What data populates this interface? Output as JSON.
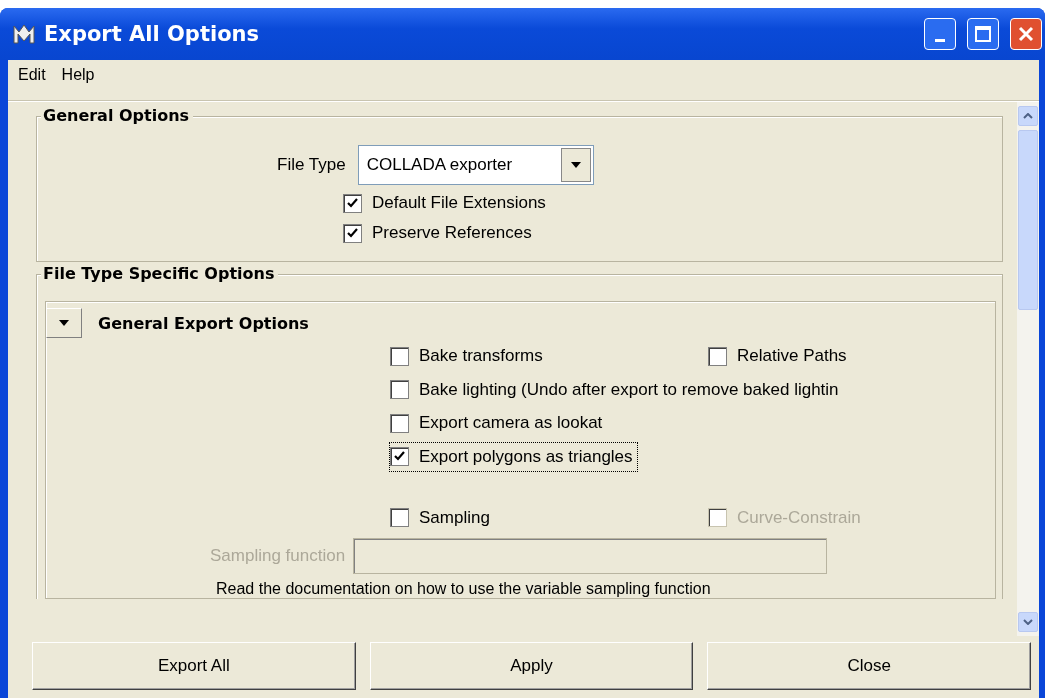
{
  "window": {
    "title": "Export All Options"
  },
  "menu": [
    "Edit",
    "Help"
  ],
  "general_options": {
    "title": "General Options",
    "file_type": {
      "label": "File Type",
      "value": "COLLADA exporter"
    },
    "checkboxes": [
      {
        "label": "Default File Extensions",
        "checked": true
      },
      {
        "label": "Preserve References",
        "checked": true
      }
    ]
  },
  "specific_options": {
    "title": "File Type Specific Options",
    "section": {
      "title": "General Export Options",
      "expanded": true,
      "rows": [
        [
          {
            "label": "Bake transforms",
            "checked": false,
            "disabled": false,
            "focused": false
          },
          {
            "label": "Relative Paths",
            "checked": false,
            "disabled": false,
            "focused": false
          }
        ],
        [
          {
            "label": "Bake lighting (Undo after export to remove baked lightin",
            "checked": false,
            "disabled": false,
            "focused": false
          }
        ],
        [
          {
            "label": "Export camera as lookat",
            "checked": false,
            "disabled": false,
            "focused": false
          }
        ],
        [
          {
            "label": "Export polygons as triangles",
            "checked": true,
            "disabled": false,
            "focused": true
          }
        ],
        [
          {
            "label": "Sampling",
            "checked": false,
            "disabled": false,
            "focused": false
          },
          {
            "label": "Curve-Constrain",
            "checked": false,
            "disabled": true,
            "focused": false
          }
        ]
      ],
      "sampling_function": {
        "label": "Sampling function",
        "disabled": true
      },
      "note": "Read the documentation on how to use the variable sampling function"
    }
  },
  "buttons": [
    "Export All",
    "Apply",
    "Close"
  ]
}
